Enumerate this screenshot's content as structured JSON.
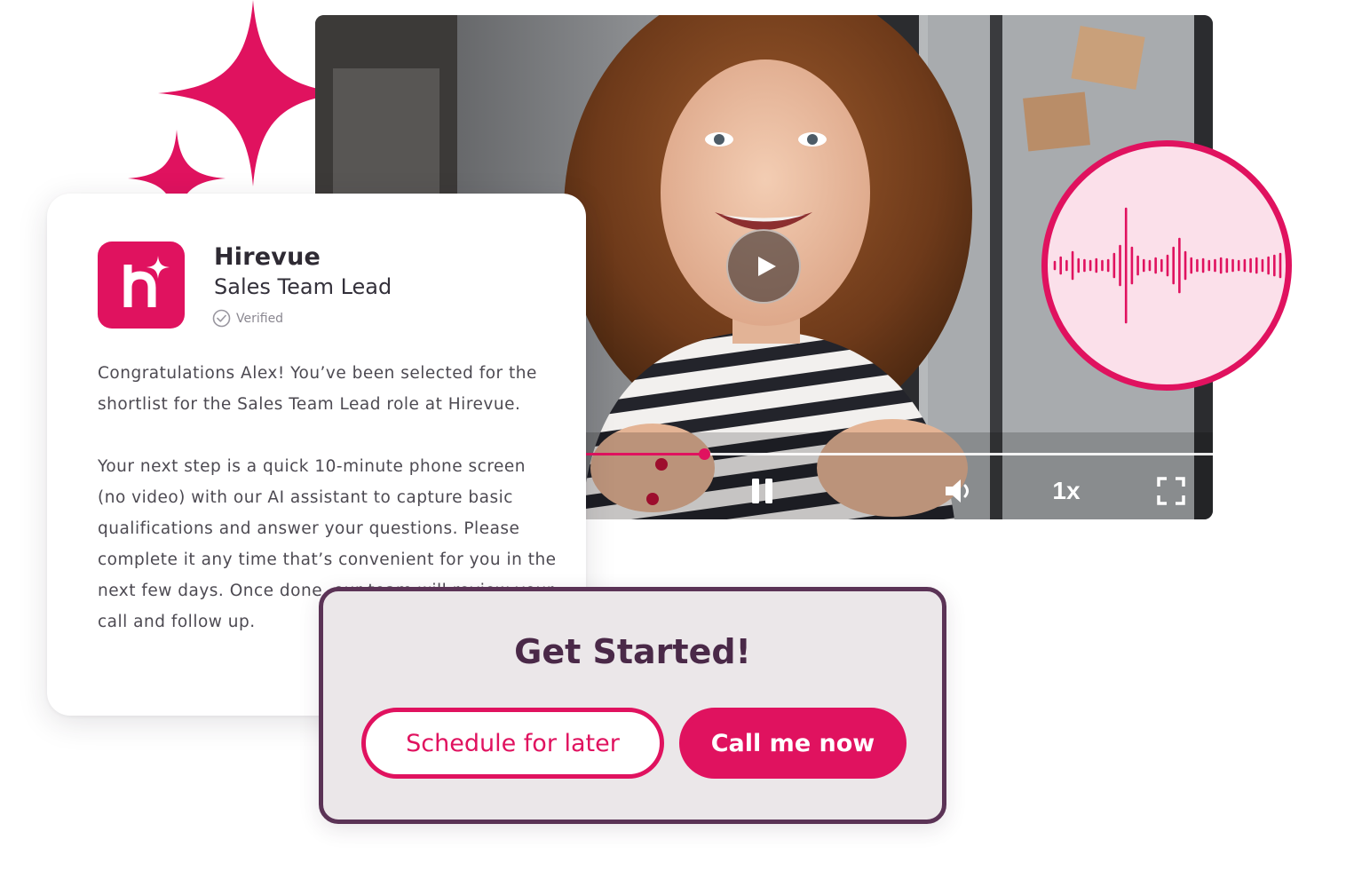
{
  "brand": {
    "accent_color": "#e0125f",
    "dark_purple": "#4a2948",
    "panel_border": "#5b3356"
  },
  "card": {
    "logo_icon": "hirevue-logo-icon",
    "company": "Hirevue",
    "role": "Sales Team Lead",
    "verified_label": "Verified",
    "verified_icon": "check-circle-icon",
    "paragraph_1": "Congratulations Alex! You’ve been selected for the shortlist for the Sales Team Lead role at Hirevue.",
    "paragraph_2": "Your next step is a quick 10-minute phone screen (no video) with our AI assistant to capture basic qualifications and answer your questions. Please complete it any time that’s convenient for you in the next few days. Once done, our team will review your call and follow up."
  },
  "video": {
    "play_icon": "play-icon",
    "pause_icon": "pause-icon",
    "volume_icon": "volume-icon",
    "speed_label": "1x",
    "fullscreen_icon": "fullscreen-icon",
    "progress_fraction": 0.433
  },
  "audio": {
    "icon": "audio-waveform-icon"
  },
  "get_started": {
    "title": "Get Started!",
    "schedule_label": "Schedule for later",
    "call_label": "Call me now"
  }
}
